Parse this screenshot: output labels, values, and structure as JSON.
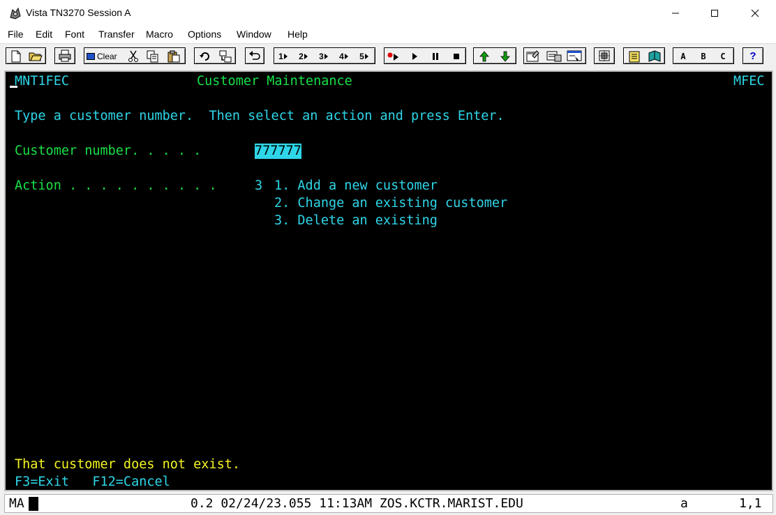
{
  "window": {
    "title": "Vista TN3270 Session A"
  },
  "menu": [
    "File",
    "Edit",
    "Font",
    "Transfer",
    "Macro",
    "Options",
    "Window",
    "Help"
  ],
  "toolbar": {
    "clear_label": "Clear",
    "macro_numbers": [
      "1",
      "2",
      "3",
      "4",
      "5"
    ],
    "letters": [
      "A",
      "B",
      "C"
    ],
    "help_label": "?"
  },
  "screen": {
    "program_id": "MNT1FEC",
    "title": "Customer Maintenance",
    "transaction_id": "MFEC",
    "instruction": "Type a customer number.  Then select an action and press Enter.",
    "customer_label": "Customer number. . . . .",
    "customer_value": "777777",
    "action_label": "Action . . . . . . . . . .",
    "action_value": "3",
    "options": [
      "1. Add a new customer",
      "2. Change an existing customer",
      "3. Delete an existing"
    ],
    "message": "That customer does not exist.",
    "fkeys": "F3=Exit   F12=Cancel"
  },
  "status": {
    "mode": "MA",
    "info": "0.2 02/24/23.055 11:13AM ZOS.KCTR.MARIST.EDU",
    "case": "a",
    "position": "1,1"
  },
  "colors": {
    "terminal_bg": "#000000",
    "field_cyan": "#2ed6e8",
    "label_green": "#19e046",
    "message_yellow": "#f5f522"
  }
}
